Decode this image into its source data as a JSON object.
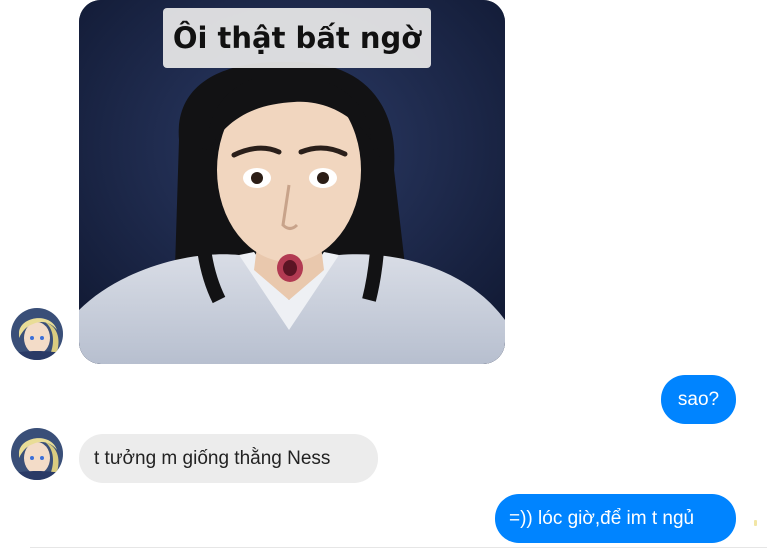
{
  "conversation": {
    "messages": [
      {
        "sender": "other",
        "type": "image",
        "caption": "Ôi thật bất ngờ"
      },
      {
        "sender": "me",
        "type": "text",
        "text": "sao?"
      },
      {
        "sender": "other",
        "type": "text",
        "text": "t tưởng m giống thằng Ness"
      },
      {
        "sender": "me",
        "type": "text",
        "text": "=)) lóc giờ,để im t ngủ"
      }
    ]
  },
  "colors": {
    "outgoing_bubble": "#0084ff",
    "incoming_bubble": "#ececec",
    "background": "#ffffff"
  },
  "icons": {
    "avatar": "anime-character-avatar"
  }
}
